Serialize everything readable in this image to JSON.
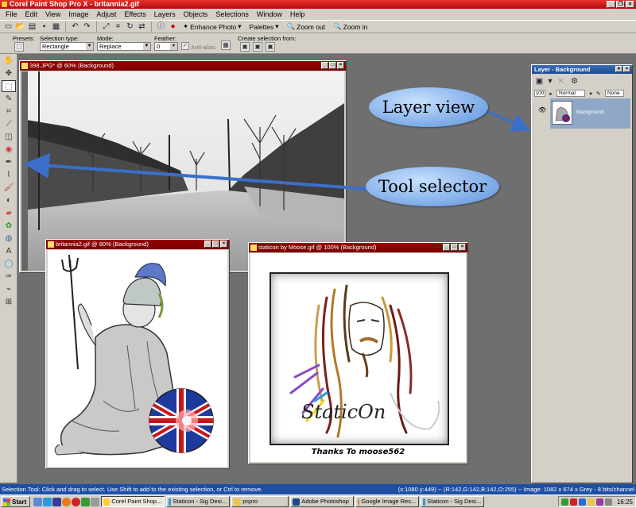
{
  "window": {
    "title": "Corel Paint Shop Pro X - britannia2.gif"
  },
  "menu": [
    "File",
    "Edit",
    "View",
    "Image",
    "Adjust",
    "Effects",
    "Layers",
    "Objects",
    "Selections",
    "Window",
    "Help"
  ],
  "toolbar": {
    "enhance_photo": "Enhance Photo",
    "palettes": "Palettes",
    "zoom_out": "Zoom out",
    "zoom_in": "Zoom in"
  },
  "options": {
    "presets_label": "Presets:",
    "selection_type_label": "Selection type:",
    "selection_type_value": "Rectangle",
    "mode_label": "Mode:",
    "mode_value": "Replace",
    "feather_label": "Feather:",
    "feather_value": "0",
    "antialias_label": "Anti-alias",
    "create_selection_label": "Create selection from:"
  },
  "docs": {
    "street": {
      "title": "398.JPG* @ 60% (Background)"
    },
    "britannia": {
      "title": "britannia2.gif @ 80% (Background)"
    },
    "staticon": {
      "title": "staticon by Moose.gif @ 100% (Background)",
      "signature": "StaticOn",
      "caption": "Thanks To moose562"
    }
  },
  "layer_panel": {
    "title": "Layer - Background",
    "opacity": "100",
    "blend_mode": "Normal",
    "lock": "None",
    "layer_name": "Background"
  },
  "callouts": {
    "layer_view": "Layer view",
    "tool_selector": "Tool selector"
  },
  "status": {
    "left": "Selection Tool: Click and drag to select. Use Shift to add to the existing selection, or Ctrl to remove.",
    "right": "(x:1080 y:449) -- (R:142,G:142,B:142,O:255) -- Image: 1082 x 674 x Grey - 8 bits/channel"
  },
  "taskbar": {
    "start": "Start",
    "tasks": [
      "Corel Paint Shop...",
      "Staticon - Sig Desi...",
      "pspro",
      "Adobe Photoshop",
      "Google Image Res...",
      "Staticon - Sig Desi..."
    ],
    "clock": "16:25"
  },
  "colors": {
    "title_red": "#c8161b",
    "doc_title": "#8b0000",
    "status_blue": "#1f4ea3",
    "callout_blue": "#7aa9e6"
  }
}
